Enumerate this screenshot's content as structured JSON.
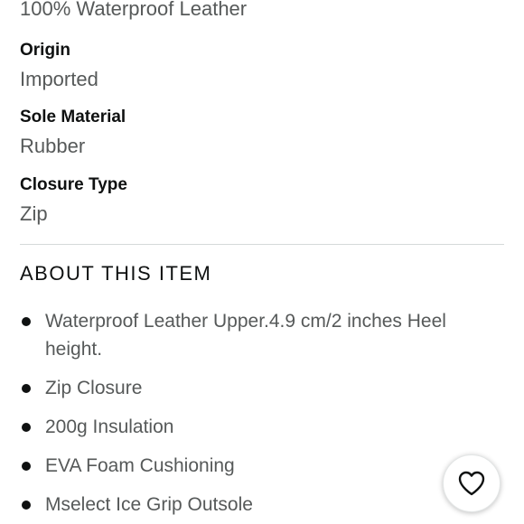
{
  "material": {
    "value": "100% Waterproof Leather"
  },
  "specs": [
    {
      "label": "Origin",
      "value": "Imported"
    },
    {
      "label": "Sole Material",
      "value": "Rubber"
    },
    {
      "label": "Closure Type",
      "value": "Zip"
    }
  ],
  "about": {
    "heading": "ABOUT THIS ITEM",
    "bullets": [
      "Waterproof Leather Upper.4.9 cm/2 inches Heel height.",
      "Zip Closure",
      "200g Insulation",
      "EVA Foam Cushioning",
      "Mselect Ice Grip Outsole"
    ]
  },
  "wishlist": {
    "icon": "heart-icon"
  },
  "colors": {
    "text_primary": "#0f1111",
    "text_secondary": "#565959",
    "divider": "#d5d9d9"
  }
}
